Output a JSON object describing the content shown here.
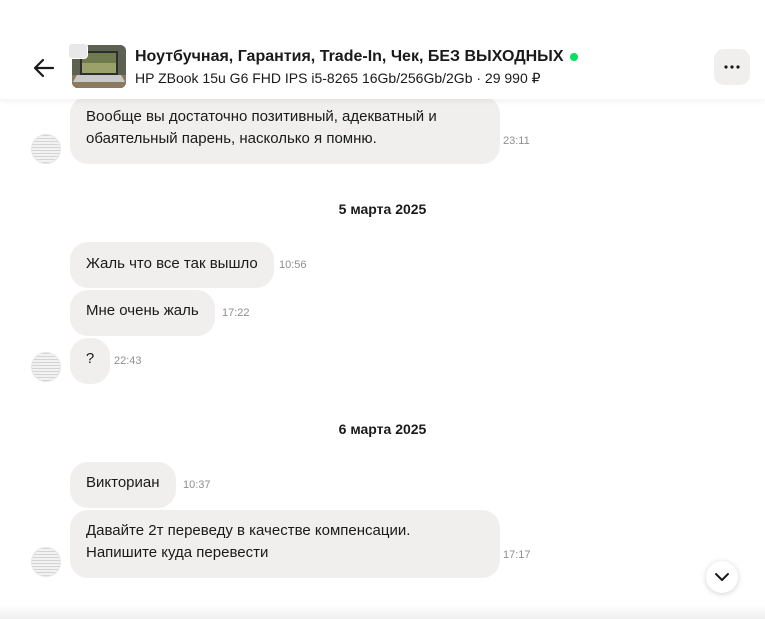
{
  "header": {
    "title": "Ноутбучная, Гарантия, Trade-In, Чек, БЕЗ ВЫХОДНЫХ",
    "subtitle": "HP ZBook 15u G6 FHD IPS i5-8265 16Gb/256Gb/2Gb · 29 990 ₽",
    "online_color": "#04e061"
  },
  "messages": [
    {
      "text": "Вообще вы достаточно позитивный, адекватный и обаятельный парень, насколько я помню.",
      "time": "23:11"
    },
    {
      "text": "Жаль что все так вышло",
      "time": "10:56"
    },
    {
      "text": "Мне очень жаль",
      "time": "17:22"
    },
    {
      "text": "?",
      "time": "22:43"
    },
    {
      "text": "Викториан",
      "time": "10:37"
    },
    {
      "text": "Давайте 2т переведу в качестве компенсации. Напишите куда перевести",
      "time": "17:17"
    }
  ],
  "dates": [
    "5 марта 2025",
    "6 марта 2025"
  ],
  "icons": {
    "back": "arrow-left-icon",
    "more": "ellipsis-icon",
    "scroll": "chevron-down-icon"
  },
  "colors": {
    "bubble": "#f0efed",
    "timestamp": "#8f8f8f"
  }
}
